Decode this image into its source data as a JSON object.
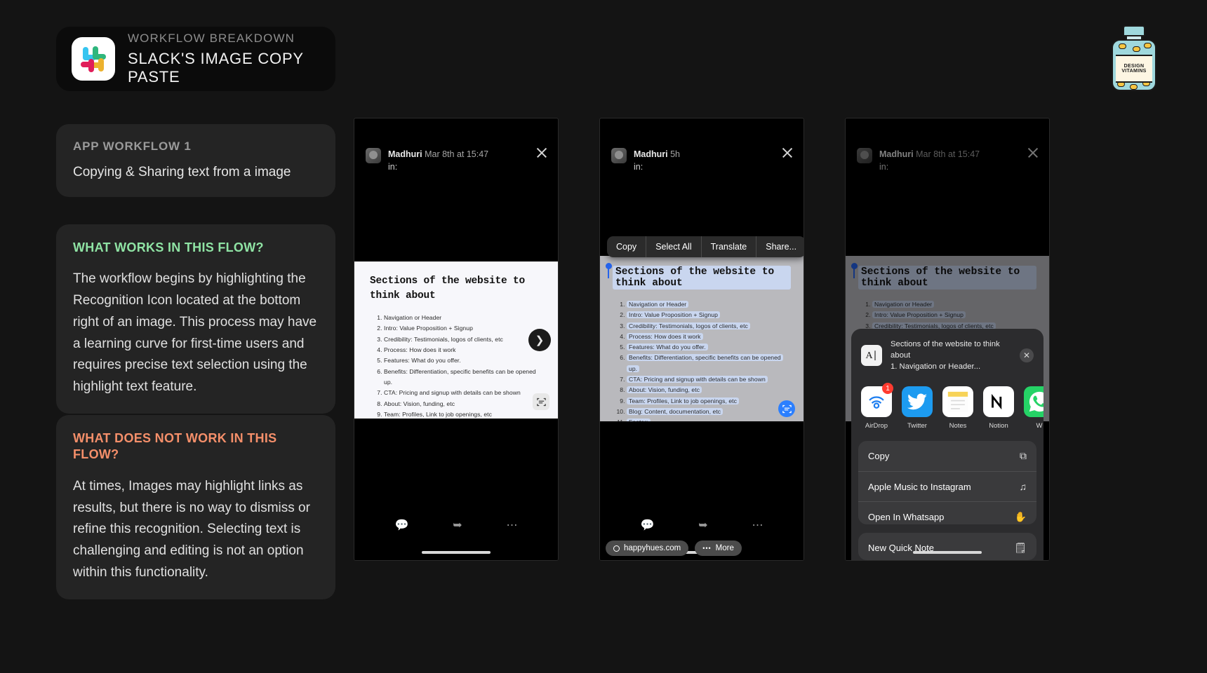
{
  "header": {
    "kicker": "WORKFLOW BREAKDOWN",
    "title": "SLACK'S IMAGE COPY PASTE",
    "logo_icon": "slack-logo-icon"
  },
  "badge": {
    "line1": "DESIGN",
    "line2": "VITAMINS"
  },
  "cards": {
    "workflow": {
      "kicker": "APP WORKFLOW 1",
      "text": "Copying & Sharing text from a image"
    },
    "works": {
      "heading": "WHAT WORKS IN THIS FLOW?",
      "body": "The workflow begins by highlighting the Recognition Icon located at the bottom right of an image. This process may have a learning curve for first-time users and requires precise text selection using the highlight text feature.",
      "color": "#8fe3a4"
    },
    "not_works": {
      "heading": "WHAT DOES NOT WORK IN THIS FLOW?",
      "body": "At times, Images may highlight links as results, but there is no way to dismiss or refine this recognition. Selecting text is challenging and editing is not an option within this functionality.",
      "color": "#f58f6a"
    }
  },
  "document": {
    "title": "Sections of the website to think about",
    "items": [
      "Navigation or Header",
      "Intro: Value Proposition + Signup",
      "Credibility: Testimonials, logos of clients, etc",
      "Process: How does it work",
      "Features: What do you offer.",
      "Benefits: Differentiation, specific benefits can be opened up.",
      "CTA: Pricing and signup with details can be shown",
      "About: Vision, funding, etc",
      "Team: Profiles, Link to job openings, etc",
      "Blog: Content, documentation, etc",
      "Footer:"
    ]
  },
  "phone1": {
    "sender": "Madhuri",
    "timestamp": "Mar 8th at 15:47",
    "channel_label": "in:",
    "close_icon": "close-icon",
    "next_icon": "chevron-right-icon",
    "recognition_icon": "text-recognition-icon",
    "toolbar": [
      "reply-icon",
      "share-icon",
      "more-icon"
    ]
  },
  "phone2": {
    "sender": "Madhuri",
    "timestamp": "5h",
    "channel_label": "in:",
    "close_icon": "close-icon",
    "context_menu": [
      "Copy",
      "Select All",
      "Translate",
      "Share..."
    ],
    "chips": [
      {
        "label": "happyhues.com",
        "icon": "globe-icon"
      },
      {
        "label": "More",
        "icon": "more-dots-icon"
      }
    ],
    "recognition_icon": "text-recognition-icon",
    "toolbar": [
      "reply-icon",
      "share-icon",
      "more-icon"
    ]
  },
  "phone3": {
    "sender": "Madhuri",
    "timestamp": "Mar 8th at 15:47",
    "channel_label": "in:",
    "close_icon": "close-icon",
    "share_sheet": {
      "preview_icon": "text-cursor-icon",
      "preview_line1": "Sections of the website to think about",
      "preview_line2": "1. Navigation or Header...",
      "close_icon": "close-icon",
      "apps": [
        {
          "label": "AirDrop",
          "icon": "airdrop-icon",
          "badge": "1"
        },
        {
          "label": "Twitter",
          "icon": "twitter-icon",
          "badge": ""
        },
        {
          "label": "Notes",
          "icon": "notes-icon",
          "badge": ""
        },
        {
          "label": "Notion",
          "icon": "notion-icon",
          "badge": ""
        },
        {
          "label": "W",
          "icon": "whatsapp-icon",
          "badge": ""
        }
      ],
      "actions": [
        {
          "label": "Copy",
          "icon": "copy-icon"
        },
        {
          "label": "Apple Music to Instagram",
          "icon": "music-note-icon"
        },
        {
          "label": "Open In Whatsapp",
          "icon": "hand-icon"
        }
      ],
      "actions2": [
        {
          "label": "New Quick Note",
          "icon": "quick-note-icon"
        }
      ]
    },
    "recognition_icon": "text-recognition-icon"
  }
}
